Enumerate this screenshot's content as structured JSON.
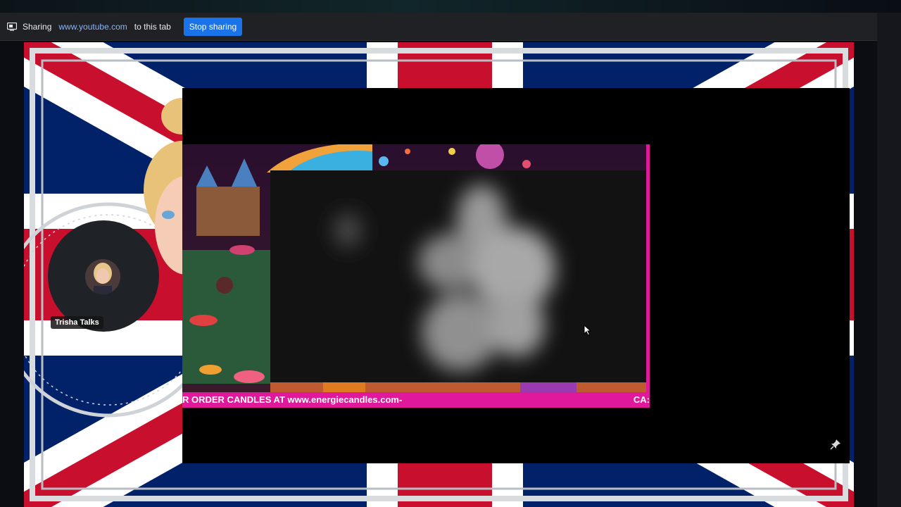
{
  "share_bar": {
    "sharing_label": "Sharing",
    "url": "www.youtube.com",
    "target": "to this tab",
    "stop_button": "Stop sharing"
  },
  "participant": {
    "name": "Trisha Talks"
  },
  "stream": {
    "ticker_text": "R ORDER CANDLES AT www.energiecandles.com-",
    "ticker_tail": "CA:"
  },
  "colors": {
    "flag_red": "#c8102e",
    "flag_blue": "#012169",
    "ticker_pink": "#e0189a",
    "button_blue": "#1a73e8"
  },
  "icons": {
    "share_icon": "screen-share-icon",
    "cursor": "mouse-pointer-icon",
    "corner": "pin-icon"
  }
}
